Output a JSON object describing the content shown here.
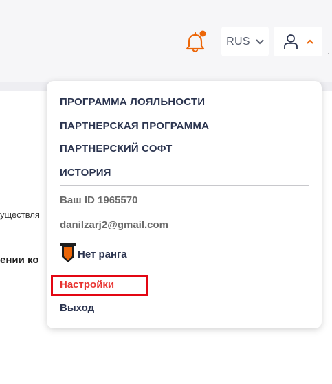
{
  "header": {
    "language": "RUS"
  },
  "background": {
    "text_1": "уществля",
    "text_2": "ении ко"
  },
  "dropdown": {
    "menu": [
      "ПРОГРАММА ЛОЯЛЬНОСТИ",
      "ПАРТНЕРСКАЯ ПРОГРАММА",
      "ПАРТНЕРСКИЙ СОФТ",
      "ИСТОРИЯ"
    ],
    "user_id": "Ваш ID 1965570",
    "email": "danilzarj2@gmail.com",
    "rank": "Нет ранга",
    "settings": "Настройки",
    "logout": "Выход"
  },
  "colors": {
    "accent": "#ec6608",
    "settings_text": "#e8322f",
    "highlight_box": "#e30613",
    "menu_text": "#2c3550"
  },
  "icons": [
    "bell-icon",
    "chevron-down-icon",
    "user-icon",
    "chevron-up-icon",
    "rank-badge-icon"
  ]
}
